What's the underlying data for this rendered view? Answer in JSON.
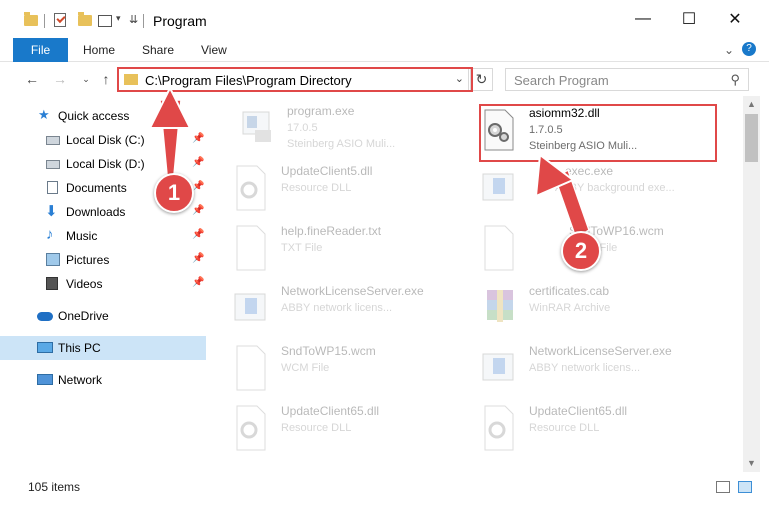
{
  "window": {
    "title": "Program"
  },
  "ribbon": {
    "tabs": [
      "File",
      "Home",
      "Share",
      "View"
    ],
    "expand_icon": "chevron-down-icon",
    "help_icon": "help-icon"
  },
  "navigation": {
    "address": "C:\\Program Files\\Program Directory",
    "search_placeholder": "Search Program"
  },
  "sidebar": {
    "items": [
      {
        "label": "Quick access",
        "icon": "star-icon",
        "pinned": false
      },
      {
        "label": "Local Disk (C:)",
        "icon": "disk-icon",
        "pinned": true
      },
      {
        "label": "Local Disk (D:)",
        "icon": "disk-icon",
        "pinned": true
      },
      {
        "label": "Documents",
        "icon": "documents-icon",
        "pinned": true
      },
      {
        "label": "Downloads",
        "icon": "download-icon",
        "pinned": true
      },
      {
        "label": "Music",
        "icon": "music-icon",
        "pinned": true
      },
      {
        "label": "Pictures",
        "icon": "pictures-icon",
        "pinned": true
      },
      {
        "label": "Videos",
        "icon": "videos-icon",
        "pinned": true
      },
      {
        "label": "OneDrive",
        "icon": "cloud-icon",
        "pinned": false
      },
      {
        "label": "This PC",
        "icon": "pc-icon",
        "pinned": false,
        "selected": true
      },
      {
        "label": "Network",
        "icon": "network-icon",
        "pinned": false
      }
    ]
  },
  "files": {
    "left": [
      {
        "name": "program.exe",
        "line1": "17.0.5",
        "line2": "Steinberg ASIO Muli...",
        "icon": "exe-icon"
      },
      {
        "name": "UpdateClient5.dll",
        "line1": "Resource DLL",
        "line2": "",
        "icon": "dll-icon"
      },
      {
        "name": "help.fineReader.txt",
        "line1": "TXT File",
        "line2": "",
        "icon": "txt-icon"
      },
      {
        "name": "NetworkLicenseServer.exe",
        "line1": "ABBY network licens...",
        "line2": "",
        "icon": "exe-icon"
      },
      {
        "name": "SndToWP15.wcm",
        "line1": "WCM File",
        "line2": "",
        "icon": "file-icon"
      },
      {
        "name": "UpdateClient65.dll",
        "line1": "Resource DLL",
        "line2": "",
        "icon": "dll-icon"
      }
    ],
    "right": [
      {
        "name": "asiomm32.dll",
        "line1": "1.7.0.5",
        "line2": "Steinberg ASIO Muli...",
        "icon": "dll-gear-icon",
        "highlighted": true
      },
      {
        "name": "...exec.exe",
        "line1": "ABBY background exe...",
        "line2": "",
        "icon": "exe-icon"
      },
      {
        "name": "SndToWP16.wcm",
        "line1": "WCM File",
        "line2": "",
        "icon": "file-icon"
      },
      {
        "name": "certificates.cab",
        "line1": "WinRAR Archive",
        "line2": "",
        "icon": "winrar-icon"
      },
      {
        "name": "NetworkLicenseServer.exe",
        "line1": "ABBY network licens...",
        "line2": "",
        "icon": "exe-icon"
      },
      {
        "name": "UpdateClient65.dll",
        "line1": "Resource DLL",
        "line2": "",
        "icon": "dll-icon"
      }
    ]
  },
  "status": {
    "item_count": "105 items"
  },
  "annotations": {
    "step1": "1",
    "step2": "2",
    "color": "#e04848"
  }
}
